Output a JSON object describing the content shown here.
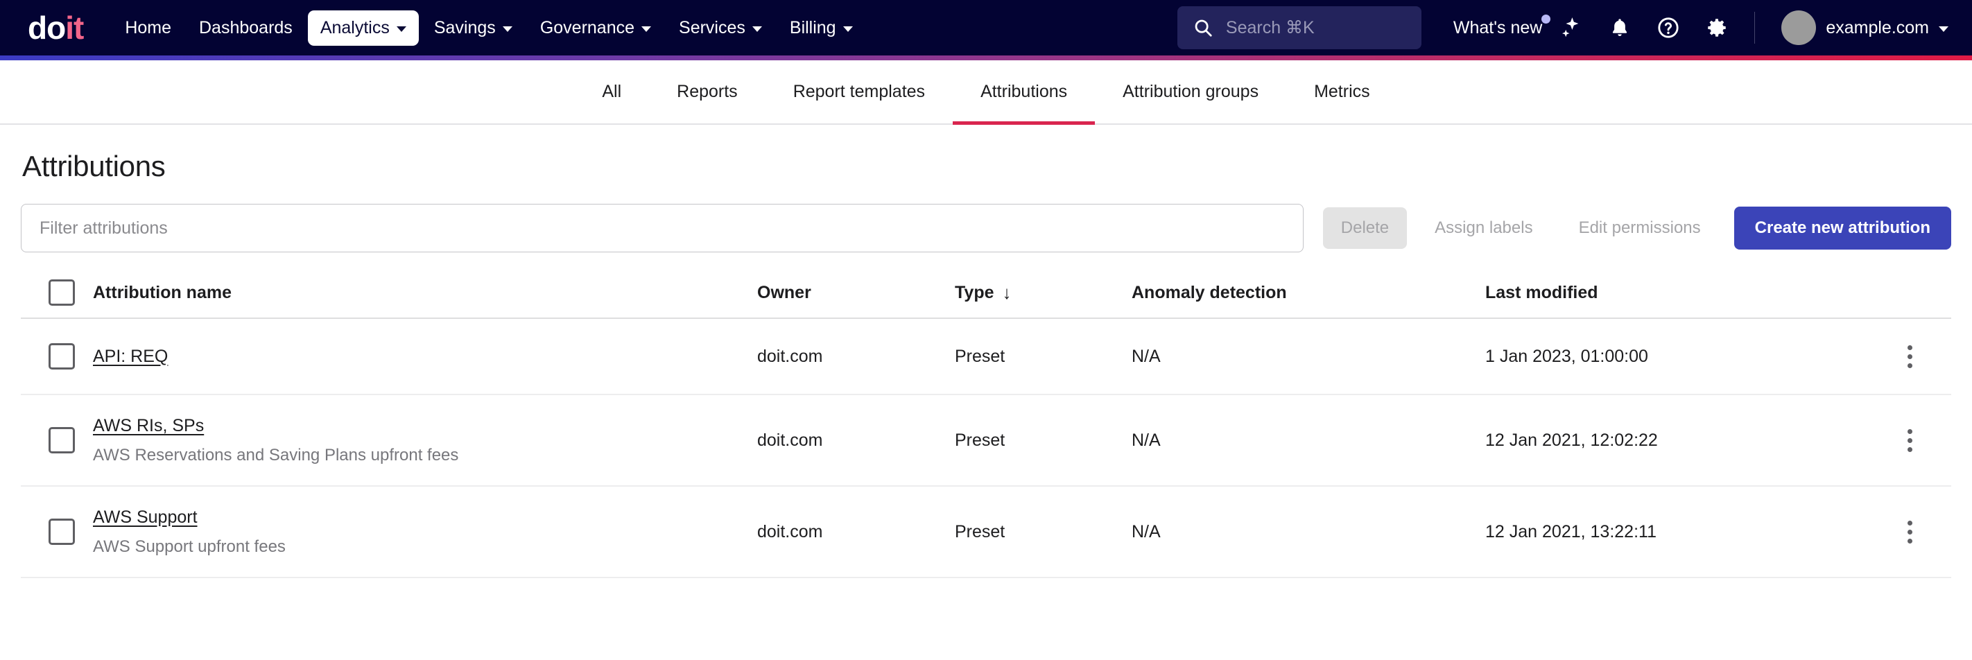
{
  "navbar": {
    "logo": {
      "part1": "do",
      "part2": "it"
    },
    "items": [
      {
        "label": "Home",
        "has_caret": false,
        "active": false
      },
      {
        "label": "Dashboards",
        "has_caret": false,
        "active": false
      },
      {
        "label": "Analytics",
        "has_caret": true,
        "active": true
      },
      {
        "label": "Savings",
        "has_caret": true,
        "active": false
      },
      {
        "label": "Governance",
        "has_caret": true,
        "active": false
      },
      {
        "label": "Services",
        "has_caret": true,
        "active": false
      },
      {
        "label": "Billing",
        "has_caret": true,
        "active": false
      }
    ],
    "search": {
      "placeholder": "Search ⌘K",
      "icon": "search-icon"
    },
    "whats_new": {
      "label": "What's new",
      "badge": true
    },
    "icons": [
      "sparkle-icon",
      "bell-icon",
      "help-circle-icon",
      "gear-icon"
    ],
    "account": {
      "label": "example.com",
      "avatar": "avatar"
    },
    "background_color": "#030333",
    "accent_pink": "#f3658a"
  },
  "gradient_bar": {
    "from": "#3b3bc4",
    "to": "#e01b46"
  },
  "tabs": [
    {
      "label": "All",
      "active": false
    },
    {
      "label": "Reports",
      "active": false
    },
    {
      "label": "Report templates",
      "active": false
    },
    {
      "label": "Attributions",
      "active": true
    },
    {
      "label": "Attribution groups",
      "active": false
    },
    {
      "label": "Metrics",
      "active": false
    }
  ],
  "tab_active_color": "#d9254e",
  "page": {
    "title": "Attributions"
  },
  "toolbar": {
    "filter_placeholder": "Filter attributions",
    "filter_value": "",
    "delete_label": "Delete",
    "assign_labels_label": "Assign labels",
    "edit_permissions_label": "Edit permissions",
    "create_label": "Create new attribution",
    "primary_color": "#3b44b8"
  },
  "table": {
    "headers": {
      "name": "Attribution name",
      "owner": "Owner",
      "type": "Type",
      "type_sort": "↓",
      "anomaly": "Anomaly detection",
      "modified": "Last modified"
    },
    "rows": [
      {
        "name": "API: REQ",
        "subtitle": "",
        "owner": "doit.com",
        "type": "Preset",
        "anomaly": "N/A",
        "modified": "1 Jan 2023, 01:00:00"
      },
      {
        "name": "AWS RIs, SPs",
        "subtitle": "AWS Reservations and Saving Plans upfront fees",
        "owner": "doit.com",
        "type": "Preset",
        "anomaly": "N/A",
        "modified": "12 Jan 2021, 12:02:22"
      },
      {
        "name": "AWS Support",
        "subtitle": "AWS Support upfront fees",
        "owner": "doit.com",
        "type": "Preset",
        "anomaly": "N/A",
        "modified": "12 Jan 2021, 13:22:11"
      }
    ]
  }
}
